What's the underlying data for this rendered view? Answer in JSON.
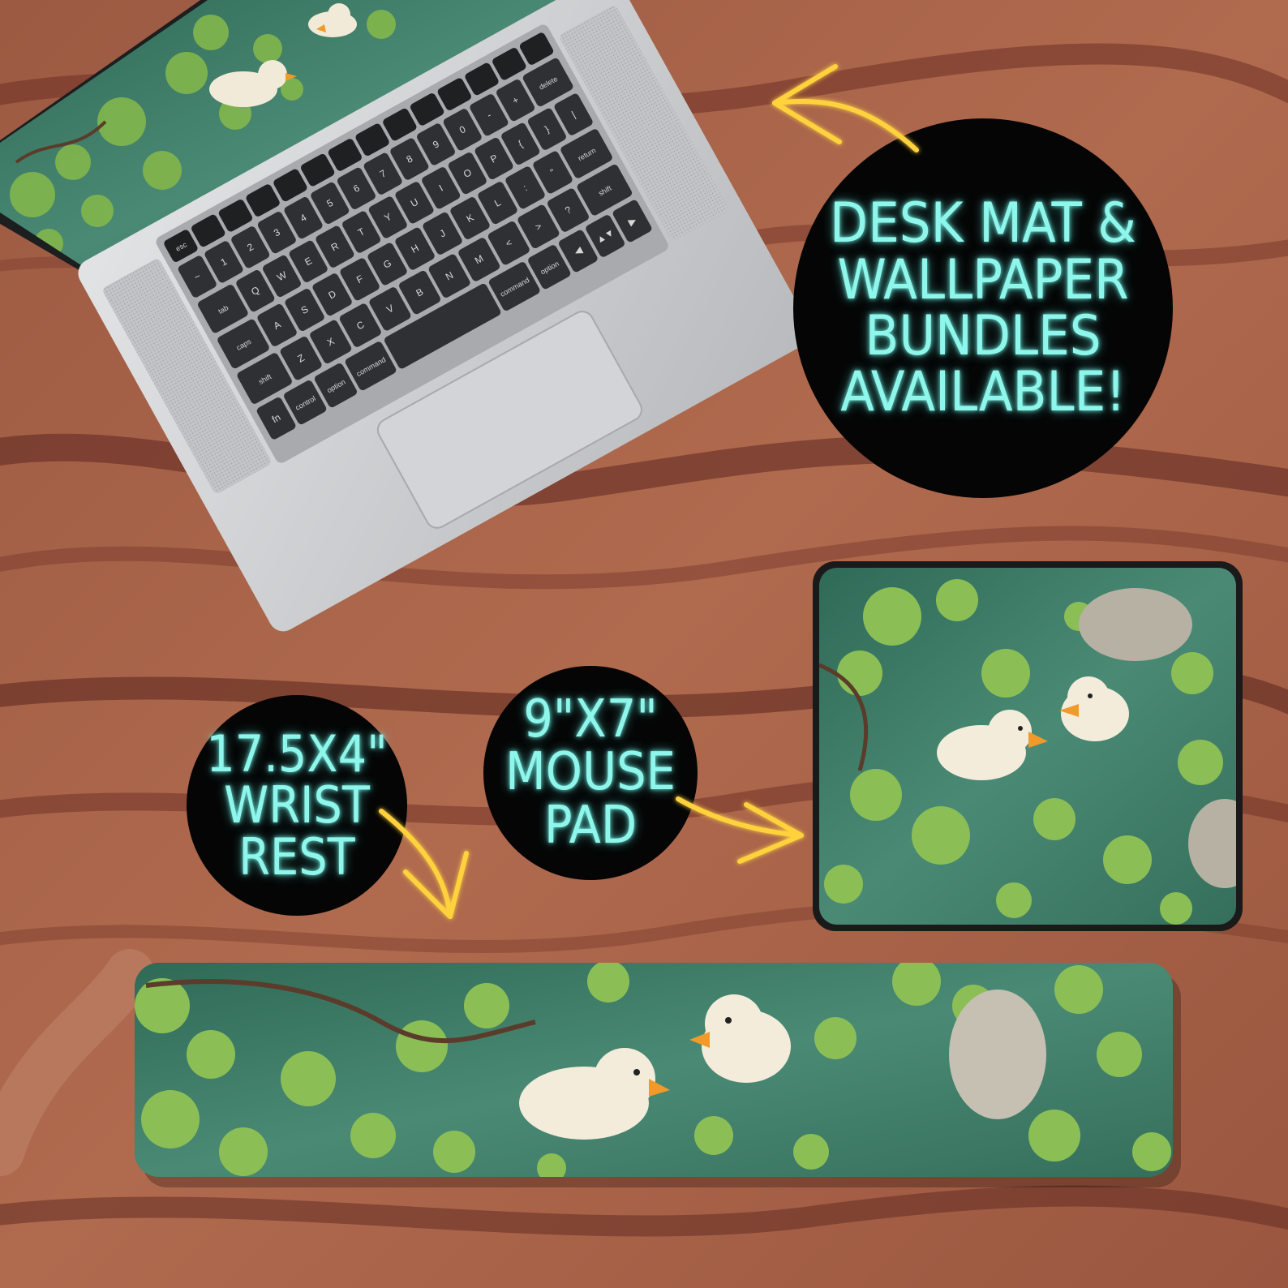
{
  "colors": {
    "wood_light": "#a9644a",
    "wood_dark": "#5a2a22",
    "badge_bg": "#050505",
    "neon_text": "#8ff6ec",
    "arrow_gold": "#ffd23c",
    "pond_water": "#3f7a66",
    "lily_pad": "#8bbf56",
    "laptop_silver": "#c9cacc",
    "key_dark": "#2f3033"
  },
  "badges": {
    "bundle": {
      "lines": [
        "DESK MAT &",
        "WALLPAPER",
        "BUNDLES",
        "AVAILABLE!"
      ]
    },
    "wrist_rest": {
      "lines": [
        "17.5X4\"",
        "WRIST",
        "REST"
      ]
    },
    "mouse_pad": {
      "lines": [
        "9\"X7\"",
        "MOUSE",
        "PAD"
      ]
    }
  },
  "keyboard": {
    "rows": [
      [
        "esc",
        "",
        "",
        "",
        "",
        "",
        "",
        "",
        "",
        "",
        "",
        "",
        "",
        ""
      ],
      [
        "~",
        "1",
        "2",
        "3",
        "4",
        "5",
        "6",
        "7",
        "8",
        "9",
        "0",
        "-",
        "+",
        "delete"
      ],
      [
        "tab",
        "Q",
        "W",
        "E",
        "R",
        "T",
        "Y",
        "U",
        "I",
        "O",
        "P",
        "{",
        "}",
        "|"
      ],
      [
        "caps",
        "A",
        "S",
        "D",
        "F",
        "G",
        "H",
        "J",
        "K",
        "L",
        ":",
        "\"",
        "return"
      ],
      [
        "shift",
        "Z",
        "X",
        "C",
        "V",
        "B",
        "N",
        "M",
        "<",
        ">",
        "?",
        "shift"
      ],
      [
        "fn",
        "control",
        "option",
        "command",
        "",
        "command",
        "option",
        "◀",
        "▲▼",
        "▶"
      ]
    ]
  },
  "icons": {
    "arrows": [
      "curved-arrow-icon",
      "curved-arrow-icon",
      "curved-arrow-icon"
    ]
  }
}
